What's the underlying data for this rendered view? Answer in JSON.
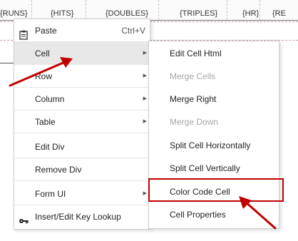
{
  "document": {
    "column_headers": [
      "{RUNS}",
      "{HITS}",
      "{DOUBLES}",
      "{TRIPLES}",
      "{HR}",
      "{RE"
    ]
  },
  "context_menu": {
    "items": [
      {
        "label": "Paste",
        "shortcut": "Ctrl+V",
        "icon": "clipboard-icon",
        "submenu": false
      },
      {
        "label": "Cell",
        "submenu": true,
        "hovered": true
      },
      {
        "label": "Row",
        "submenu": true
      },
      {
        "label": "Column",
        "submenu": true
      },
      {
        "label": "Table",
        "submenu": true
      },
      {
        "label": "Edit Div",
        "submenu": false
      },
      {
        "label": "Remove Div",
        "submenu": false
      },
      {
        "label": "Form UI",
        "submenu": true
      },
      {
        "label": "Insert/Edit Key Lookup",
        "icon": "key-icon",
        "submenu": false
      }
    ]
  },
  "cell_submenu": {
    "items": [
      {
        "label": "Edit Cell Html",
        "disabled": false
      },
      {
        "label": "Merge Cells",
        "disabled": true
      },
      {
        "label": "Merge Right",
        "disabled": false
      },
      {
        "label": "Merge Down",
        "disabled": true
      },
      {
        "label": "Split Cell Horizontally",
        "disabled": false
      },
      {
        "label": "Split Cell Vertically",
        "disabled": false
      },
      {
        "label": "Color Code Cell",
        "disabled": false,
        "highlighted": true
      },
      {
        "label": "Cell Properties",
        "disabled": false
      }
    ]
  },
  "colors": {
    "annotation_red": "#c00000",
    "hover_bg": "#e8e8e8",
    "disabled_text": "#a6a6a6"
  }
}
